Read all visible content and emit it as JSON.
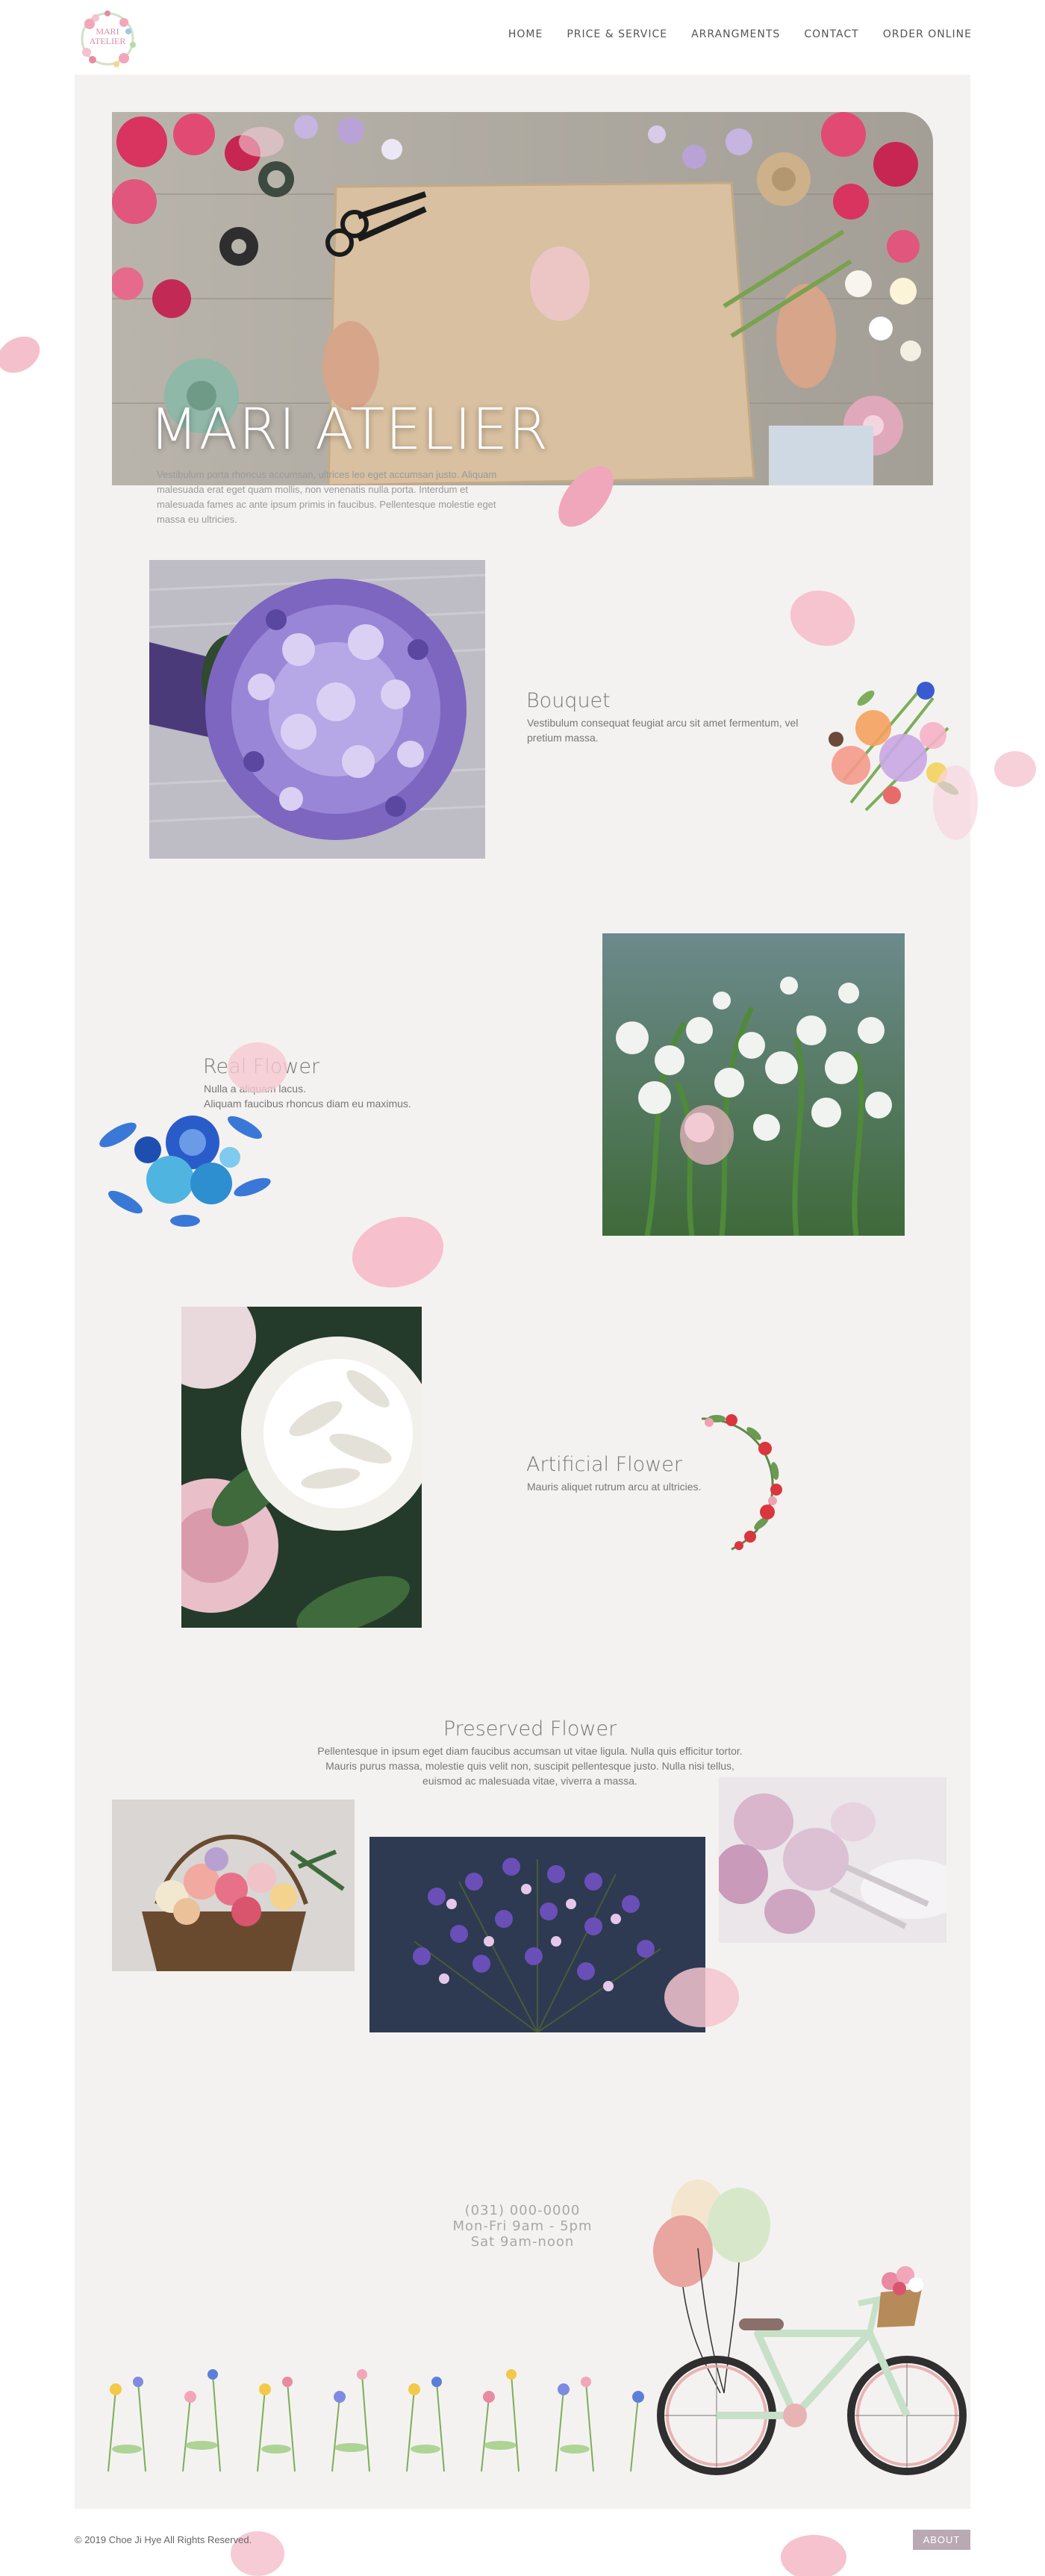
{
  "header": {
    "logo_line1": "MARI",
    "logo_line2": "ATELIER",
    "nav": [
      "HOME",
      "PRICE & SERVICE",
      "ARRANGMENTS",
      "CONTACT",
      "ORDER ONLINE"
    ]
  },
  "hero": {
    "title": "MARI ATELIER",
    "description": "Vestibulum porta rhoncus accumsan, ultrices leo eget accumsan justo. Aliquam malesuada erat eget quam mollis, non venenatis nulla porta. Interdum et malesuada fames ac ante ipsum primis in faucibus. Pellentesque molestie eget massa eu ultricies."
  },
  "sections": {
    "bouquet": {
      "title": "Bouquet",
      "description": "Vestibulum consequat feugiat arcu sit amet fermentum, vel pretium massa."
    },
    "real": {
      "title": "Real Flower",
      "description_line1": "Nulla a aliquam lacus.",
      "description_line2": "Aliquam faucibus rhoncus diam eu maximus."
    },
    "artificial": {
      "title": "Artificial Flower",
      "description": "Mauris aliquet rutrum arcu at ultricies."
    },
    "preserved": {
      "title": "Preserved Flower",
      "description": "Pellentesque in ipsum eget diam faucibus accumsan ut vitae ligula. Nulla quis efficitur tortor. Mauris purus massa, molestie quis velit non, suscipit pellentesque justo. Nulla nisi tellus, euismod ac malesuada vitae, viverra a massa."
    }
  },
  "contact": {
    "phone": "(031) 000-0000",
    "hours_weekday": "Mon-Fri   9am - 5pm",
    "hours_saturday": "Sat 9am-noon"
  },
  "footer": {
    "copyright": "© 2019 Choe Ji Hye All Rights Reserved.",
    "about_label": "ABOUT"
  },
  "colors": {
    "panel": "#f4f2f0",
    "accent_pink": "#e99bb0",
    "about_button": "#b9a9b3"
  },
  "icons": [
    "petal-icon",
    "floral-wreath-icon",
    "bicycle-icon",
    "balloon-icon",
    "wildflower-border-icon"
  ]
}
